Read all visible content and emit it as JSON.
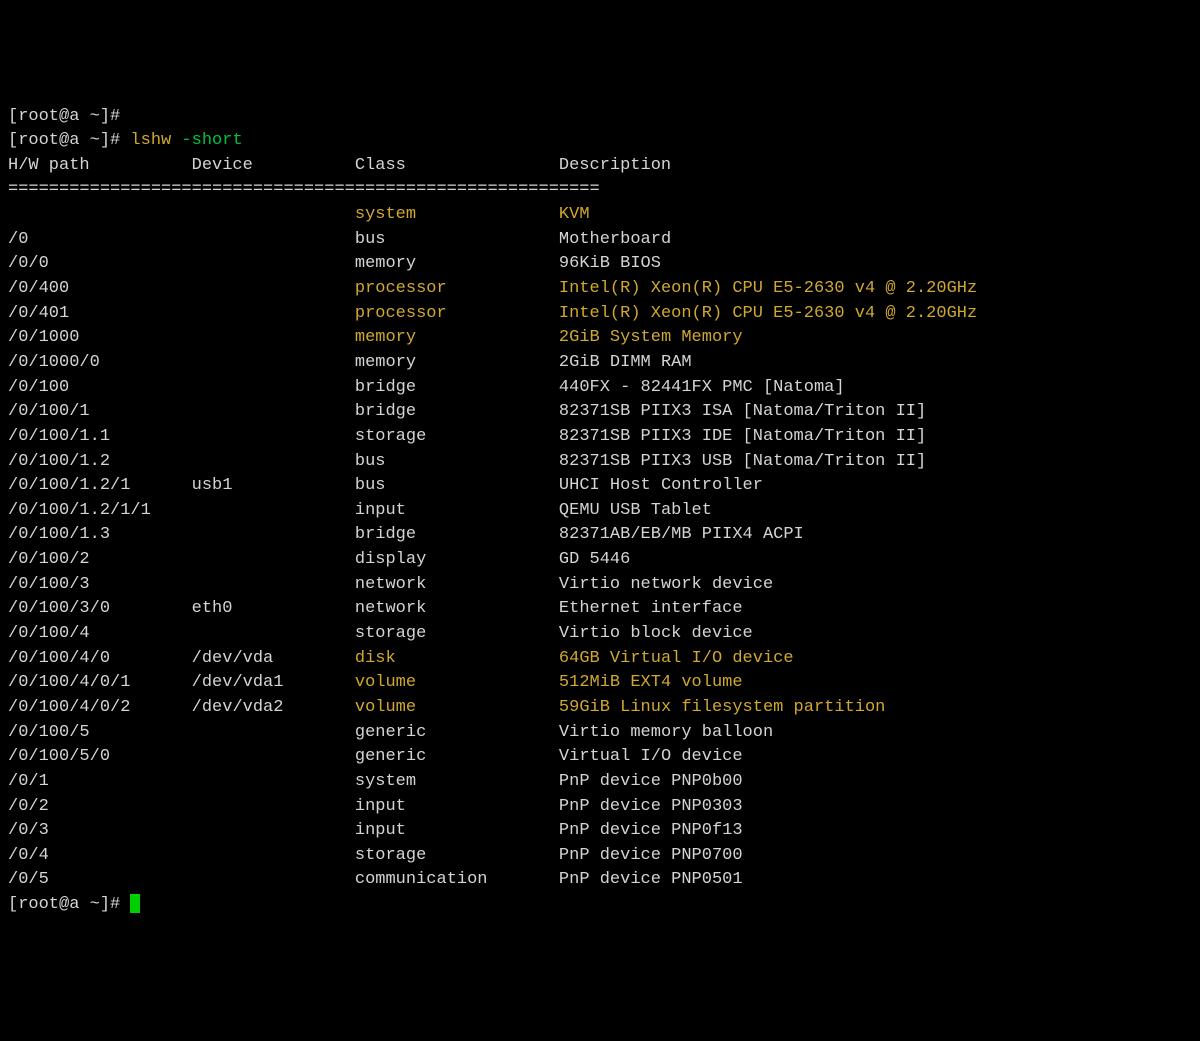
{
  "prompt": "[root@a ~]# ",
  "command": "lshw",
  "command_arg": " -short",
  "header": {
    "path": "H/W path",
    "device": "Device",
    "class": "Class",
    "description": "Description"
  },
  "separator": "==========================================================",
  "rows": [
    {
      "path": "",
      "device": "",
      "class": "system",
      "desc": "KVM",
      "hl": true
    },
    {
      "path": "/0",
      "device": "",
      "class": "bus",
      "desc": "Motherboard",
      "hl": false
    },
    {
      "path": "/0/0",
      "device": "",
      "class": "memory",
      "desc": "96KiB BIOS",
      "hl": false
    },
    {
      "path": "/0/400",
      "device": "",
      "class": "processor",
      "desc": "Intel(R) Xeon(R) CPU E5-2630 v4 @ 2.20GHz",
      "hl": true
    },
    {
      "path": "/0/401",
      "device": "",
      "class": "processor",
      "desc": "Intel(R) Xeon(R) CPU E5-2630 v4 @ 2.20GHz",
      "hl": true
    },
    {
      "path": "/0/1000",
      "device": "",
      "class": "memory",
      "desc": "2GiB System Memory",
      "hl": true
    },
    {
      "path": "/0/1000/0",
      "device": "",
      "class": "memory",
      "desc": "2GiB DIMM RAM",
      "hl": false
    },
    {
      "path": "/0/100",
      "device": "",
      "class": "bridge",
      "desc": "440FX - 82441FX PMC [Natoma]",
      "hl": false
    },
    {
      "path": "/0/100/1",
      "device": "",
      "class": "bridge",
      "desc": "82371SB PIIX3 ISA [Natoma/Triton II]",
      "hl": false
    },
    {
      "path": "/0/100/1.1",
      "device": "",
      "class": "storage",
      "desc": "82371SB PIIX3 IDE [Natoma/Triton II]",
      "hl": false
    },
    {
      "path": "/0/100/1.2",
      "device": "",
      "class": "bus",
      "desc": "82371SB PIIX3 USB [Natoma/Triton II]",
      "hl": false
    },
    {
      "path": "/0/100/1.2/1",
      "device": "usb1",
      "class": "bus",
      "desc": "UHCI Host Controller",
      "hl": false
    },
    {
      "path": "/0/100/1.2/1/1",
      "device": "",
      "class": "input",
      "desc": "QEMU USB Tablet",
      "hl": false
    },
    {
      "path": "/0/100/1.3",
      "device": "",
      "class": "bridge",
      "desc": "82371AB/EB/MB PIIX4 ACPI",
      "hl": false
    },
    {
      "path": "/0/100/2",
      "device": "",
      "class": "display",
      "desc": "GD 5446",
      "hl": false
    },
    {
      "path": "/0/100/3",
      "device": "",
      "class": "network",
      "desc": "Virtio network device",
      "hl": false
    },
    {
      "path": "/0/100/3/0",
      "device": "eth0",
      "class": "network",
      "desc": "Ethernet interface",
      "hl": false
    },
    {
      "path": "/0/100/4",
      "device": "",
      "class": "storage",
      "desc": "Virtio block device",
      "hl": false
    },
    {
      "path": "/0/100/4/0",
      "device": "/dev/vda",
      "class": "disk",
      "desc": "64GB Virtual I/O device",
      "hl": true
    },
    {
      "path": "/0/100/4/0/1",
      "device": "/dev/vda1",
      "class": "volume",
      "desc": "512MiB EXT4 volume",
      "hl": true
    },
    {
      "path": "/0/100/4/0/2",
      "device": "/dev/vda2",
      "class": "volume",
      "desc": "59GiB Linux filesystem partition",
      "hl": true
    },
    {
      "path": "/0/100/5",
      "device": "",
      "class": "generic",
      "desc": "Virtio memory balloon",
      "hl": false
    },
    {
      "path": "/0/100/5/0",
      "device": "",
      "class": "generic",
      "desc": "Virtual I/O device",
      "hl": false
    },
    {
      "path": "/0/1",
      "device": "",
      "class": "system",
      "desc": "PnP device PNP0b00",
      "hl": false
    },
    {
      "path": "/0/2",
      "device": "",
      "class": "input",
      "desc": "PnP device PNP0303",
      "hl": false
    },
    {
      "path": "/0/3",
      "device": "",
      "class": "input",
      "desc": "PnP device PNP0f13",
      "hl": false
    },
    {
      "path": "/0/4",
      "device": "",
      "class": "storage",
      "desc": "PnP device PNP0700",
      "hl": false
    },
    {
      "path": "/0/5",
      "device": "",
      "class": "communication",
      "desc": "PnP device PNP0501",
      "hl": false
    }
  ],
  "col_widths": {
    "path": 18,
    "device": 16,
    "class": 20
  }
}
